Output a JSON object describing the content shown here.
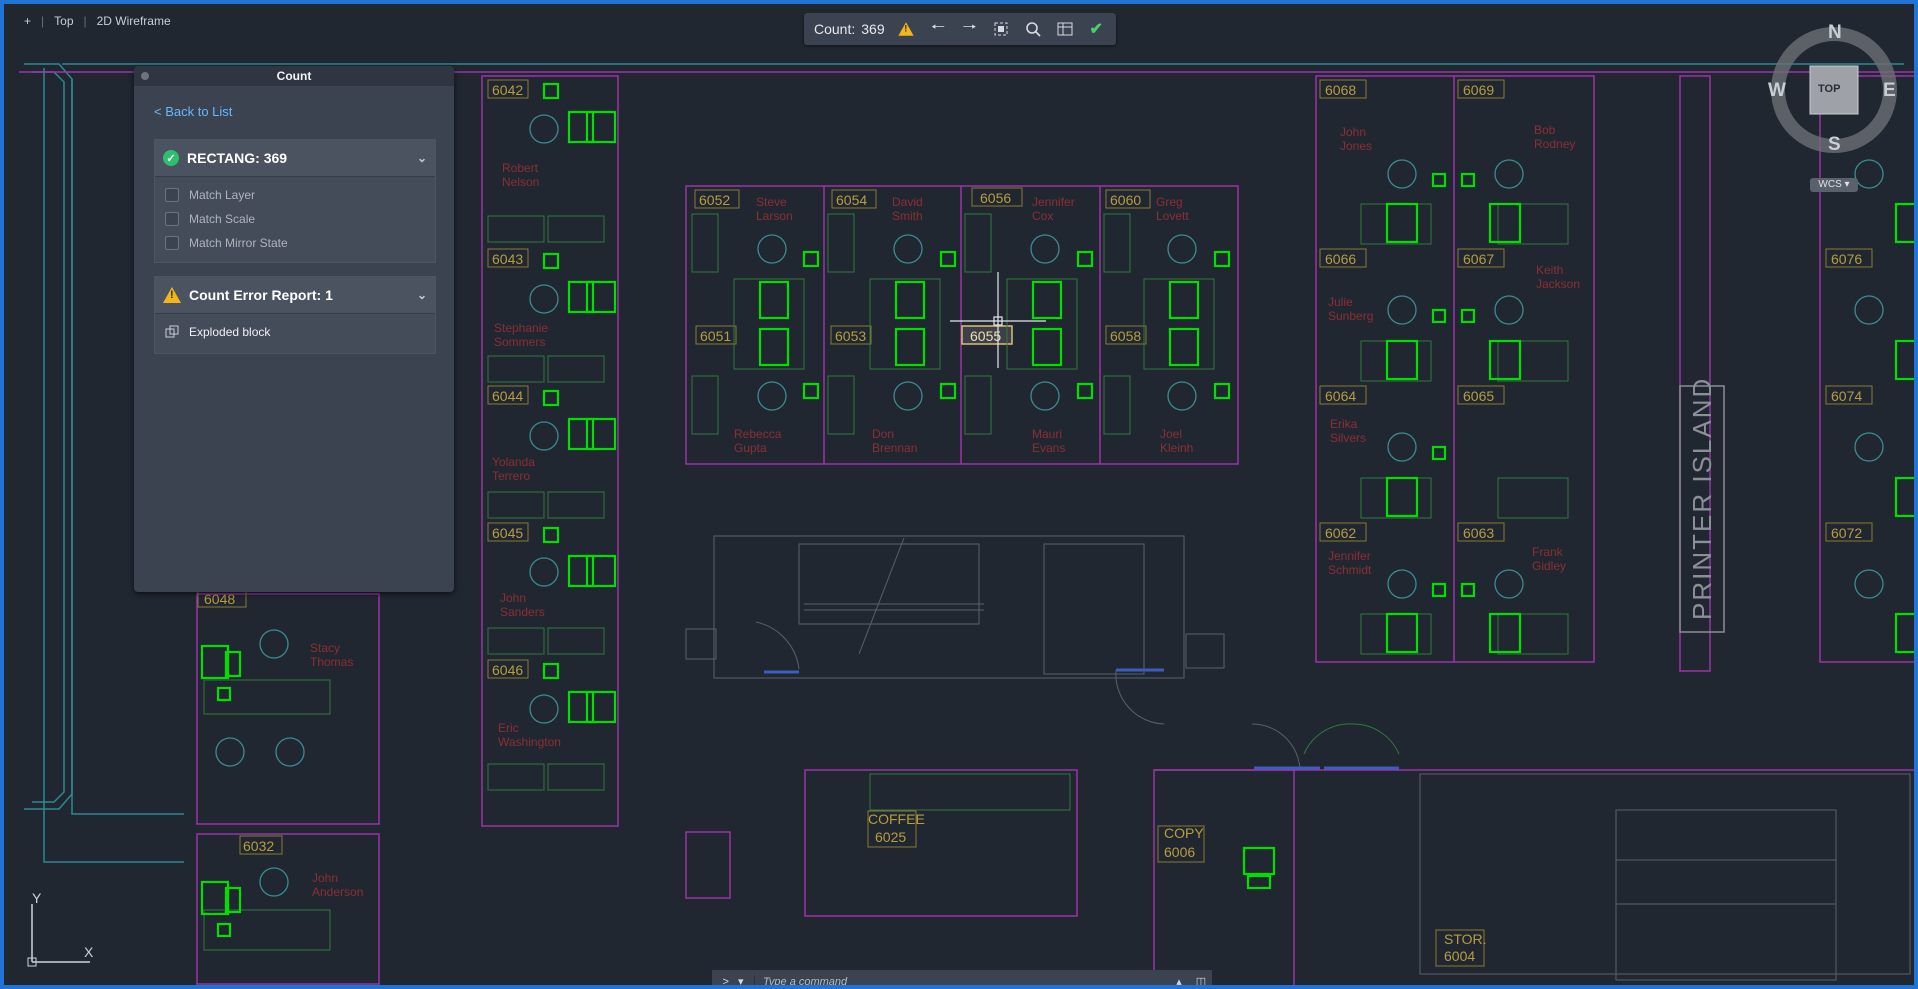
{
  "viewport": {
    "plus": "+",
    "view": "Top",
    "style": "2D Wireframe"
  },
  "count_toolbar": {
    "label": "Count:",
    "count": "369",
    "icons": [
      "warning-icon",
      "prev-arrow-icon",
      "next-arrow-icon",
      "zoom-extents-icon",
      "find-icon",
      "table-icon",
      "checkmark-icon"
    ]
  },
  "palette": {
    "title": "Count",
    "back_link": "< Back to List",
    "block_section": {
      "title": "RECTANG: 369",
      "options": [
        "Match Layer",
        "Match Scale",
        "Match Mirror State"
      ]
    },
    "error_section": {
      "title": "Count Error Report: 1",
      "items": [
        "Exploded block"
      ]
    }
  },
  "command_line": {
    "prompt": ">_",
    "placeholder": "Type a command"
  },
  "viewcube": {
    "face": "TOP",
    "n": "N",
    "s": "S",
    "e": "E",
    "w": "W",
    "coord_system": "WCS"
  },
  "ucs": {
    "x": "X",
    "y": "Y"
  },
  "rooms": [
    "6042",
    "6043",
    "6044",
    "6045",
    "6046",
    "6048",
    "6032",
    "6052",
    "6054",
    "6056",
    "6060",
    "6051",
    "6053",
    "6055",
    "6058",
    "6068",
    "6069",
    "6066",
    "6067",
    "6064",
    "6065",
    "6062",
    "6063",
    "6076",
    "6074",
    "6072",
    "6025",
    "6006",
    "6004"
  ],
  "names": {
    "n1": [
      "Robert",
      "Nelson"
    ],
    "n2": [
      "Stephanie",
      "Sommers"
    ],
    "n3": [
      "Yolanda",
      "Terrero"
    ],
    "n4": [
      "John",
      "Sanders"
    ],
    "n5": [
      "Eric",
      "Washington"
    ],
    "n6": [
      "Stacy",
      "Thomas"
    ],
    "n7": [
      "John",
      "Anderson"
    ],
    "n8": [
      "Steve",
      "Larson"
    ],
    "n9": [
      "David",
      "Smith"
    ],
    "n10": [
      "Jennifer",
      "Cox"
    ],
    "n11": [
      "Greg",
      "Lovett"
    ],
    "n12": [
      "Rebecca",
      "Gupta"
    ],
    "n13": [
      "Don",
      "Brennan"
    ],
    "n14": [
      "Mauri",
      "Evans"
    ],
    "n15": [
      "Joel",
      "Kleinh"
    ],
    "n16": [
      "John",
      "Jones"
    ],
    "n17": [
      "Bob",
      "Rodney"
    ],
    "n18": [
      "Julie",
      "Sunberg"
    ],
    "n19": [
      "Keith",
      "Jackson"
    ],
    "n20": [
      "Erika",
      "Silvers"
    ],
    "n21": [
      "Jennifer",
      "Schmidt"
    ],
    "n22": [
      "Frank",
      "Gidley"
    ]
  },
  "labels": {
    "printer_island": "PRINTER ISLAND",
    "coffee": "COFFEE",
    "copy": "COPY",
    "stor": "STOR."
  },
  "colors": {
    "background": "#212731",
    "highlight": "#00e000",
    "walls": "#9b34a8",
    "room_tags": "#b79d3e",
    "names": "#8a2f33",
    "frame": "#1f74d6"
  }
}
